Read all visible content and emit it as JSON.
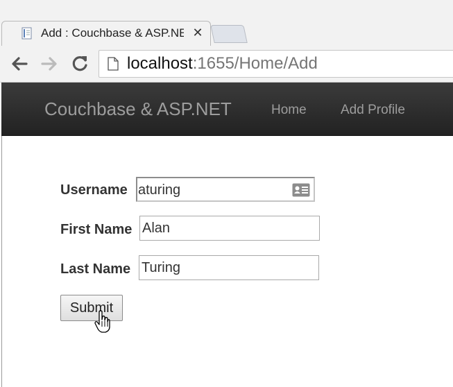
{
  "browser": {
    "active_tab": {
      "title": "Add : Couchbase & ASP.NET",
      "close_glyph": "✕",
      "favicon": "document-icon"
    },
    "new_tab": {
      "icon": "new-tab-icon"
    },
    "toolbar": {
      "back_icon": "back-arrow-icon",
      "forward_icon": "forward-arrow-icon",
      "reload_icon": "reload-icon"
    },
    "address": {
      "host": "localhost",
      "rest": ":1655/Home/Add",
      "page_icon": "page-icon"
    }
  },
  "navbar": {
    "brand": "Couchbase & ASP.NET",
    "links": [
      {
        "label": "Home"
      },
      {
        "label": "Add Profile"
      }
    ]
  },
  "form": {
    "username": {
      "label": "Username",
      "value": "aturing",
      "autofill_icon": "contact-card-icon"
    },
    "first_name": {
      "label": "First Name",
      "value": "Alan"
    },
    "last_name": {
      "label": "Last Name",
      "value": "Turing"
    },
    "submit_label": "Submit"
  },
  "colors": {
    "navbar_bg": "#222222",
    "navbar_text": "#9d9d9d",
    "label_text": "#333333",
    "url_path": "#757575"
  }
}
